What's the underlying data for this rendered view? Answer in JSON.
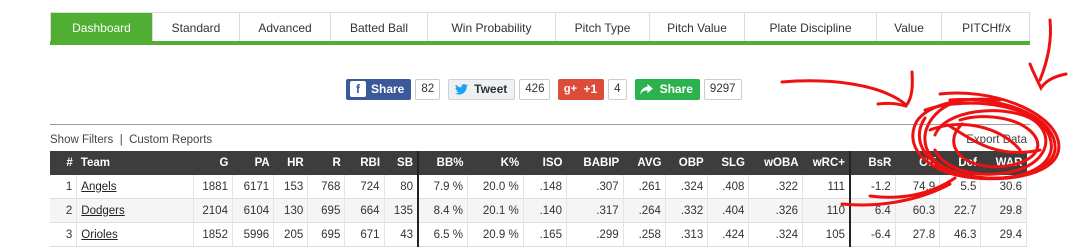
{
  "tabs": [
    {
      "label": "Dashboard",
      "active": true
    },
    {
      "label": "Standard"
    },
    {
      "label": "Advanced"
    },
    {
      "label": "Batted Ball"
    },
    {
      "label": "Win Probability"
    },
    {
      "label": "Pitch Type"
    },
    {
      "label": "Pitch Value"
    },
    {
      "label": "Plate Discipline"
    },
    {
      "label": "Value"
    },
    {
      "label": "PITCHf/x"
    }
  ],
  "share": {
    "facebook": {
      "label": "Share",
      "icon": "facebook-icon",
      "count": "82"
    },
    "twitter": {
      "label": "Tweet",
      "icon": "twitter-bird-icon",
      "count": "426"
    },
    "gplus": {
      "label": "+1",
      "icon": "google-plus-icon",
      "count": "4"
    },
    "share": {
      "label": "Share",
      "icon": "share-arrow-icon",
      "count": "9297"
    }
  },
  "filters": {
    "show_filters": "Show Filters",
    "separator": "|",
    "custom_reports": "Custom Reports",
    "export": "Export Data"
  },
  "table": {
    "headers": [
      "#",
      "Team",
      "G",
      "PA",
      "HR",
      "R",
      "RBI",
      "SB",
      "BB%",
      "K%",
      "ISO",
      "BABIP",
      "AVG",
      "OBP",
      "SLG",
      "wOBA",
      "wRC+",
      "BsR",
      "Off",
      "Def",
      "WAR"
    ],
    "rows": [
      [
        "1",
        "Angels",
        "1881",
        "6171",
        "153",
        "768",
        "724",
        "80",
        "7.9 %",
        "20.0 %",
        ".148",
        ".307",
        ".261",
        ".324",
        ".408",
        ".322",
        "111",
        "-1.2",
        "74.9",
        "5.5",
        "30.6"
      ],
      [
        "2",
        "Dodgers",
        "2104",
        "6104",
        "130",
        "695",
        "664",
        "135",
        "8.4 %",
        "20.1 %",
        ".140",
        ".317",
        ".264",
        ".332",
        ".404",
        ".326",
        "110",
        "6.4",
        "60.3",
        "22.7",
        "29.8"
      ],
      [
        "3",
        "Orioles",
        "1852",
        "5996",
        "205",
        "695",
        "671",
        "43",
        "6.5 %",
        "20.9 %",
        ".165",
        ".299",
        ".258",
        ".313",
        ".424",
        ".324",
        "105",
        "-6.4",
        "27.8",
        "46.3",
        "29.4"
      ]
    ]
  },
  "colors": {
    "accent": "#50ae32",
    "header_bg": "#3d3d3d",
    "annotation": "#ee1111"
  }
}
